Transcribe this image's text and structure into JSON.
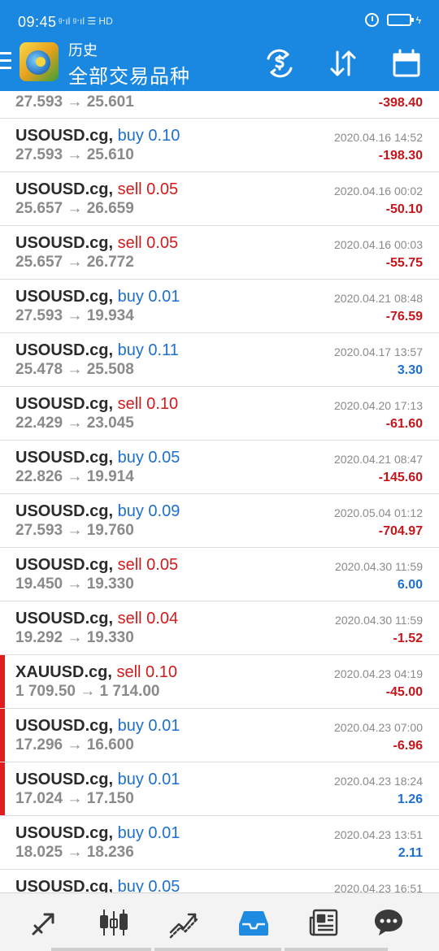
{
  "status": {
    "time": "09:45",
    "network": "ᵍ‧ıl ᵍ‧ıl ☰ HD"
  },
  "header": {
    "subtitle": "历史",
    "title": "全部交易品种"
  },
  "icons": {
    "menu": "menu-icon",
    "logo": "app-logo-icon",
    "sort_currency": "currency-sort-icon",
    "sort": "sort-arrows-icon",
    "calendar": "calendar-icon"
  },
  "colors": {
    "appbar": "#1a88e0",
    "buy": "#1d6fd0",
    "sell": "#d21b1b",
    "loss": "#c6161c",
    "gain": "#1d6fd0",
    "marker": "#e01e1e"
  },
  "trades": [
    {
      "symbol": "",
      "type": "",
      "open": "27.593",
      "close": "25.601",
      "date": "",
      "profit": "-398.40",
      "positive": false,
      "marker": false,
      "partial_top": true
    },
    {
      "symbol": "USOUSD.cg",
      "type": "buy 0.10",
      "open": "27.593",
      "close": "25.610",
      "date": "2020.04.16 14:52",
      "profit": "-198.30",
      "positive": false,
      "marker": false
    },
    {
      "symbol": "USOUSD.cg",
      "type": "sell 0.05",
      "open": "25.657",
      "close": "26.659",
      "date": "2020.04.16 00:02",
      "profit": "-50.10",
      "positive": false,
      "marker": false
    },
    {
      "symbol": "USOUSD.cg",
      "type": "sell 0.05",
      "open": "25.657",
      "close": "26.772",
      "date": "2020.04.16 00:03",
      "profit": "-55.75",
      "positive": false,
      "marker": false
    },
    {
      "symbol": "USOUSD.cg",
      "type": "buy 0.01",
      "open": "27.593",
      "close": "19.934",
      "date": "2020.04.21 08:48",
      "profit": "-76.59",
      "positive": false,
      "marker": false
    },
    {
      "symbol": "USOUSD.cg",
      "type": "buy 0.11",
      "open": "25.478",
      "close": "25.508",
      "date": "2020.04.17 13:57",
      "profit": "3.30",
      "positive": true,
      "marker": false
    },
    {
      "symbol": "USOUSD.cg",
      "type": "sell 0.10",
      "open": "22.429",
      "close": "23.045",
      "date": "2020.04.20 17:13",
      "profit": "-61.60",
      "positive": false,
      "marker": false
    },
    {
      "symbol": "USOUSD.cg",
      "type": "buy 0.05",
      "open": "22.826",
      "close": "19.914",
      "date": "2020.04.21 08:47",
      "profit": "-145.60",
      "positive": false,
      "marker": false
    },
    {
      "symbol": "USOUSD.cg",
      "type": "buy 0.09",
      "open": "27.593",
      "close": "19.760",
      "date": "2020.05.04 01:12",
      "profit": "-704.97",
      "positive": false,
      "marker": false
    },
    {
      "symbol": "USOUSD.cg",
      "type": "sell 0.05",
      "open": "19.450",
      "close": "19.330",
      "date": "2020.04.30 11:59",
      "profit": "6.00",
      "positive": true,
      "marker": false
    },
    {
      "symbol": "USOUSD.cg",
      "type": "sell 0.04",
      "open": "19.292",
      "close": "19.330",
      "date": "2020.04.30 11:59",
      "profit": "-1.52",
      "positive": false,
      "marker": false
    },
    {
      "symbol": "XAUUSD.cg",
      "type": "sell 0.10",
      "open": "1 709.50",
      "close": "1 714.00",
      "date": "2020.04.23 04:19",
      "profit": "-45.00",
      "positive": false,
      "marker": true
    },
    {
      "symbol": "USOUSD.cg",
      "type": "buy 0.01",
      "open": "17.296",
      "close": "16.600",
      "date": "2020.04.23 07:00",
      "profit": "-6.96",
      "positive": false,
      "marker": true
    },
    {
      "symbol": "USOUSD.cg",
      "type": "buy 0.01",
      "open": "17.024",
      "close": "17.150",
      "date": "2020.04.23 18:24",
      "profit": "1.26",
      "positive": true,
      "marker": true
    },
    {
      "symbol": "USOUSD.cg",
      "type": "buy 0.01",
      "open": "18.025",
      "close": "18.236",
      "date": "2020.04.23 13:51",
      "profit": "2.11",
      "positive": true,
      "marker": false
    },
    {
      "symbol": "USOUSD.cg",
      "type": "buy 0.05",
      "open": "",
      "close": "",
      "date": "2020.04.23 16:51",
      "profit": "",
      "positive": false,
      "marker": false,
      "partial_bottom": true
    }
  ],
  "bottom_nav": [
    {
      "name": "nav-quotes",
      "icon": "quotes-arrows-icon",
      "active": false
    },
    {
      "name": "nav-chart",
      "icon": "candlestick-chart-icon",
      "active": false
    },
    {
      "name": "nav-trade",
      "icon": "trade-trend-icon",
      "active": false
    },
    {
      "name": "nav-history",
      "icon": "history-inbox-icon",
      "active": true
    },
    {
      "name": "nav-news",
      "icon": "news-icon",
      "active": false
    },
    {
      "name": "nav-chat",
      "icon": "chat-icon",
      "active": false
    }
  ]
}
